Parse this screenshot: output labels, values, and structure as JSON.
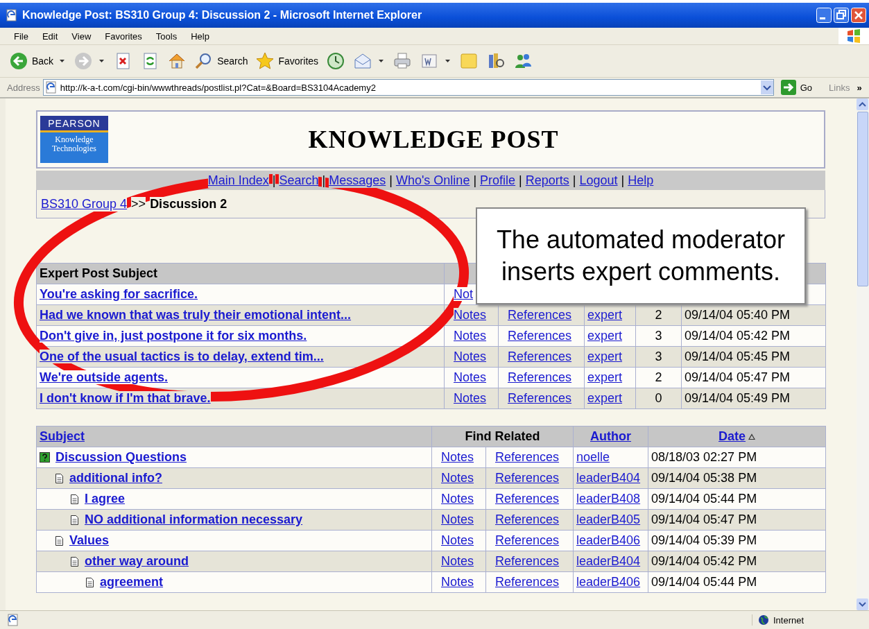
{
  "window": {
    "title": "Knowledge Post: BS310 Group 4: Discussion 2 - Microsoft Internet Explorer"
  },
  "menu": [
    "File",
    "Edit",
    "View",
    "Favorites",
    "Tools",
    "Help"
  ],
  "toolbar": [
    {
      "kind": "back",
      "label": "Back",
      "dropdown": true
    },
    {
      "kind": "forward",
      "dropdown": true
    },
    {
      "kind": "stop",
      "dropdown": false
    },
    {
      "kind": "refresh",
      "dropdown": false
    },
    {
      "kind": "home",
      "dropdown": false
    },
    {
      "kind": "search",
      "label": "Search",
      "dropdown": false
    },
    {
      "kind": "favorites",
      "label": "Favorites",
      "dropdown": false
    },
    {
      "kind": "history",
      "dropdown": false
    },
    {
      "kind": "mail",
      "dropdown": true
    },
    {
      "kind": "print",
      "dropdown": false
    },
    {
      "kind": "edit",
      "dropdown": true
    },
    {
      "kind": "note",
      "dropdown": false
    },
    {
      "kind": "research",
      "dropdown": false
    },
    {
      "kind": "messenger",
      "dropdown": false
    }
  ],
  "address": {
    "label": "Address",
    "url": "http://k-a-t.com/cgi-bin/wwwthreads/postlist.pl?Cat=&Board=BS3104Academy2",
    "go": "Go",
    "links": "Links",
    "more": "»"
  },
  "header": {
    "logo": {
      "brand": "PEARSON",
      "line_1": "Knowledge",
      "line_2": "Technologies"
    },
    "title": "KNOWLEDGE POST"
  },
  "nav": {
    "links": [
      "Main Index",
      "Search",
      "Messages",
      "Who's Online",
      "Profile",
      "Reports",
      "Logout",
      "Help"
    ],
    "separator": "|"
  },
  "breadcrumb": {
    "parent": "BS310 Group 4",
    "separator": ">>",
    "current": "Discussion 2"
  },
  "expert_table": {
    "columns": [
      "Expert Post Subject"
    ],
    "rows": [
      {
        "subject": "You're asking for sacrifice.",
        "notes": "Not"
      },
      {
        "subject": "Had we known that was truly their emotional intent...",
        "notes": "Notes",
        "references": "References",
        "author": "expert",
        "count": "2",
        "date": "09/14/04 05:40 PM"
      },
      {
        "subject": "Don't give in, just postpone it for six months.",
        "notes": "Notes",
        "references": "References",
        "author": "expert",
        "count": "3",
        "date": "09/14/04 05:42 PM"
      },
      {
        "subject": "One of the usual tactics is to delay, extend tim...",
        "notes": "Notes",
        "references": "References",
        "author": "expert",
        "count": "3",
        "date": "09/14/04 05:45 PM"
      },
      {
        "subject": "We're outside agents.",
        "notes": "Notes",
        "references": "References",
        "author": "expert",
        "count": "2",
        "date": "09/14/04 05:47 PM"
      },
      {
        "subject": "I don't know if I'm that brave.",
        "notes": "Notes",
        "references": "References",
        "author": "expert",
        "count": "0",
        "date": "09/14/04 05:49 PM"
      }
    ]
  },
  "thread_table": {
    "columns": [
      {
        "label": "Subject",
        "link": true,
        "sorted": false
      },
      {
        "label": "Find Related",
        "link": false,
        "sorted": false
      },
      {
        "label": "Author",
        "link": true,
        "sorted": false
      },
      {
        "label": "Date",
        "link": true,
        "sorted": true
      }
    ],
    "rows": [
      {
        "subject": "Discussion Questions",
        "kind": "question",
        "notes": "Notes",
        "references": "References",
        "author": "noelle",
        "date": "08/18/03 02:27 PM",
        "children": [
          {
            "subject": "additional info?",
            "kind": "post",
            "notes": "Notes",
            "references": "References",
            "author": "leaderB404",
            "date": "09/14/04 05:38 PM",
            "children": [
              {
                "subject": "I agree",
                "kind": "post",
                "notes": "Notes",
                "references": "References",
                "author": "leaderB408",
                "date": "09/14/04 05:44 PM"
              },
              {
                "subject": "NO additional information necessary",
                "kind": "post",
                "notes": "Notes",
                "references": "References",
                "author": "leaderB405",
                "date": "09/14/04 05:47 PM"
              }
            ]
          },
          {
            "subject": "Values",
            "kind": "post",
            "notes": "Notes",
            "references": "References",
            "author": "leaderB406",
            "date": "09/14/04 05:39 PM",
            "children": [
              {
                "subject": "other way around",
                "kind": "post",
                "notes": "Notes",
                "references": "References",
                "author": "leaderB404",
                "date": "09/14/04 05:42 PM",
                "children": [
                  {
                    "subject": "agreement",
                    "kind": "post",
                    "notes": "Notes",
                    "references": "References",
                    "author": "leaderB406",
                    "date": "09/14/04 05:44 PM"
                  }
                ]
              }
            ]
          }
        ]
      }
    ]
  },
  "callout": {
    "text": "The automated moderator inserts expert comments."
  },
  "status_bar": {
    "zone": "Internet"
  }
}
